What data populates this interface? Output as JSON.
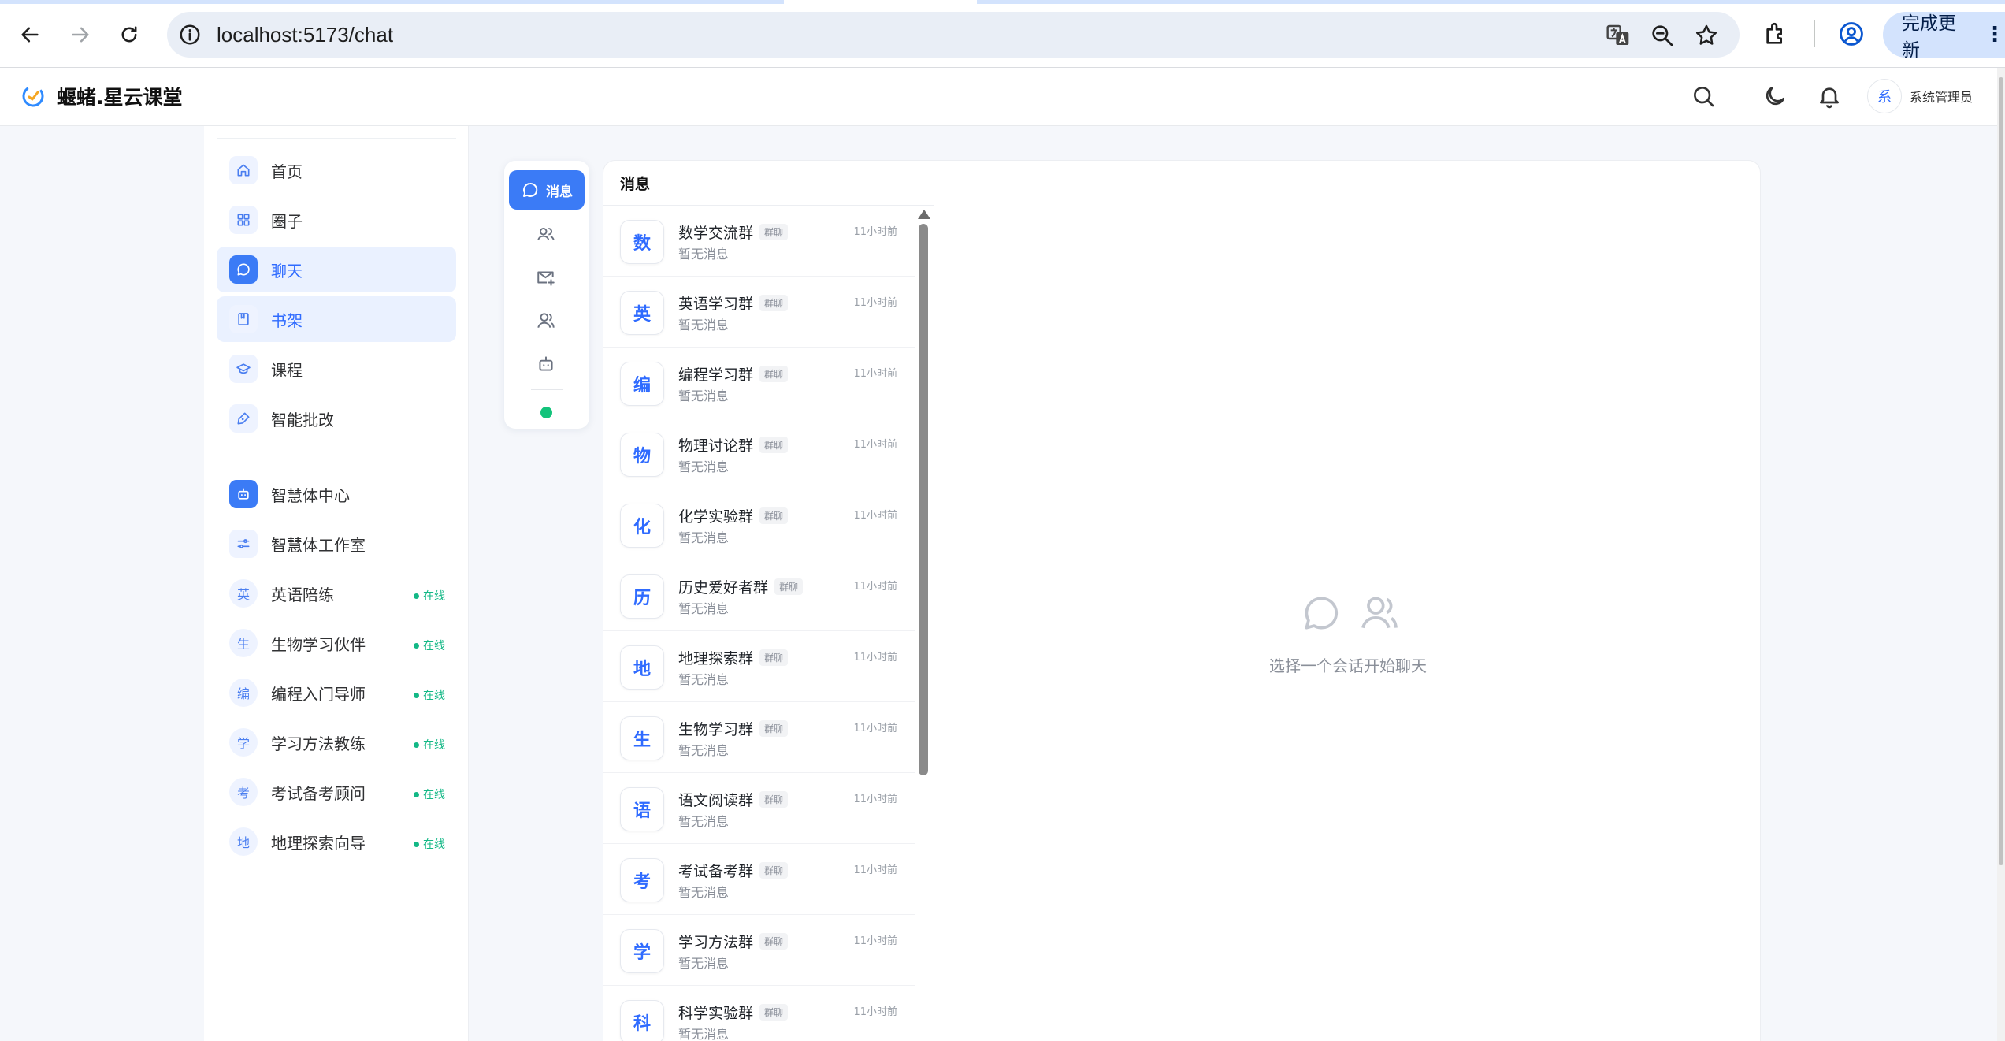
{
  "browser": {
    "url": "localhost:5173/chat",
    "update_label": "完成更新"
  },
  "app": {
    "brand": "蝘蝫.星云课堂",
    "user": {
      "avatar_letter": "系",
      "name": "系统管理员"
    }
  },
  "nav": {
    "primary": [
      {
        "label": "首页",
        "icon": "home-icon"
      },
      {
        "label": "圈子",
        "icon": "grid-icon"
      },
      {
        "label": "聊天",
        "icon": "chat-icon",
        "active": true
      },
      {
        "label": "书架",
        "icon": "book-icon",
        "active": true
      },
      {
        "label": "课程",
        "icon": "graduation-cap-icon"
      },
      {
        "label": "智能批改",
        "icon": "pen-icon"
      }
    ],
    "agents": [
      {
        "label": "智慧体中心",
        "icon": "robot-icon"
      },
      {
        "label": "智慧体工作室",
        "icon": "sliders-icon"
      }
    ],
    "assistants": [
      {
        "letter": "英",
        "label": "英语陪练",
        "status": "在线"
      },
      {
        "letter": "生",
        "label": "生物学习伙伴",
        "status": "在线"
      },
      {
        "letter": "编",
        "label": "编程入门导师",
        "status": "在线"
      },
      {
        "letter": "学",
        "label": "学习方法教练",
        "status": "在线"
      },
      {
        "letter": "考",
        "label": "考试备考顾问",
        "status": "在线"
      },
      {
        "letter": "地",
        "label": "地理探索向导",
        "status": "在线"
      }
    ]
  },
  "rail": {
    "messages_label": "消息"
  },
  "conversations": {
    "title": "消息",
    "items": [
      {
        "letter": "数",
        "name": "数学交流群",
        "tag": "群聊",
        "preview": "暂无消息",
        "time": "11小时前"
      },
      {
        "letter": "英",
        "name": "英语学习群",
        "tag": "群聊",
        "preview": "暂无消息",
        "time": "11小时前"
      },
      {
        "letter": "编",
        "name": "编程学习群",
        "tag": "群聊",
        "preview": "暂无消息",
        "time": "11小时前"
      },
      {
        "letter": "物",
        "name": "物理讨论群",
        "tag": "群聊",
        "preview": "暂无消息",
        "time": "11小时前"
      },
      {
        "letter": "化",
        "name": "化学实验群",
        "tag": "群聊",
        "preview": "暂无消息",
        "time": "11小时前"
      },
      {
        "letter": "历",
        "name": "历史爱好者群",
        "tag": "群聊",
        "preview": "暂无消息",
        "time": "11小时前"
      },
      {
        "letter": "地",
        "name": "地理探索群",
        "tag": "群聊",
        "preview": "暂无消息",
        "time": "11小时前"
      },
      {
        "letter": "生",
        "name": "生物学习群",
        "tag": "群聊",
        "preview": "暂无消息",
        "time": "11小时前"
      },
      {
        "letter": "语",
        "name": "语文阅读群",
        "tag": "群聊",
        "preview": "暂无消息",
        "time": "11小时前"
      },
      {
        "letter": "考",
        "name": "考试备考群",
        "tag": "群聊",
        "preview": "暂无消息",
        "time": "11小时前"
      },
      {
        "letter": "学",
        "name": "学习方法群",
        "tag": "群聊",
        "preview": "暂无消息",
        "time": "11小时前"
      },
      {
        "letter": "科",
        "name": "科学实验群",
        "tag": "群聊",
        "preview": "暂无消息",
        "time": "11小时前"
      }
    ]
  },
  "empty_state": {
    "text": "选择一个会话开始聊天"
  },
  "colors": {
    "accent": "#3b7bf6",
    "online": "#13b886",
    "muted": "#8a8f99"
  }
}
